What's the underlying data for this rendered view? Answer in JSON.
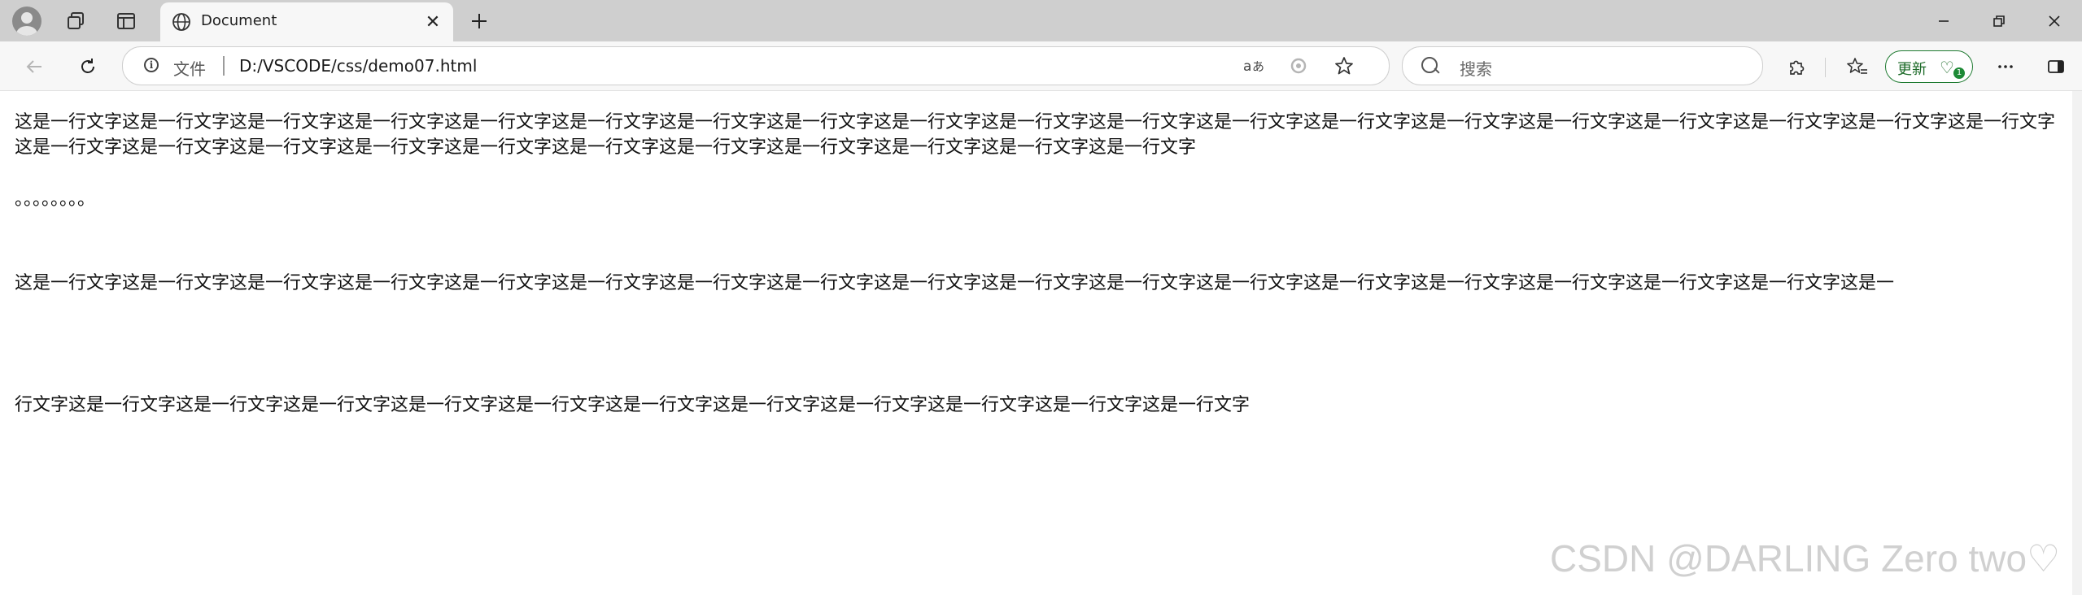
{
  "tab": {
    "title": "Document"
  },
  "address_bar": {
    "scheme_label": "文件",
    "url": "D:/VSCODE/css/demo07.html"
  },
  "search": {
    "placeholder": "搜索"
  },
  "update_button": {
    "label": "更新",
    "badge": "1"
  },
  "content": {
    "paragraph1": "这是一行文字这是一行文字这是一行文字这是一行文字这是一行文字这是一行文字这是一行文字这是一行文字这是一行文字这是一行文字这是一行文字这是一行文字这是一行文字这是一行文字这是一行文字这是一行文字这是一行文字这是一行文字这是一行文字这是一行文字这是一行文字这是一行文字这是一行文字这是一行文字这是一行文字这是一行文字这是一行文字这是一行文字这是一行文字这是一行文字",
    "dots": "。。。。。。。。",
    "line2_part1": "这是一行文字这是一行文字这是一行文字这是一行文字这是一行文字这是一行文字这是一行文字这是一行文字这是一行文字这是一行文字这是一行文字这是一行文字这是一行文字这是一行文字这是一行文字这是一行文字这是一行文字这是一",
    "line2_part2": "行文字这是一行文字这是一行文字这是一行文字这是一行文字这是一行文字这是一行文字这是一行文字这是一行文字这是一行文字这是一行文字这是一行文字"
  },
  "watermark": "CSDN @DARLING Zero two♡"
}
